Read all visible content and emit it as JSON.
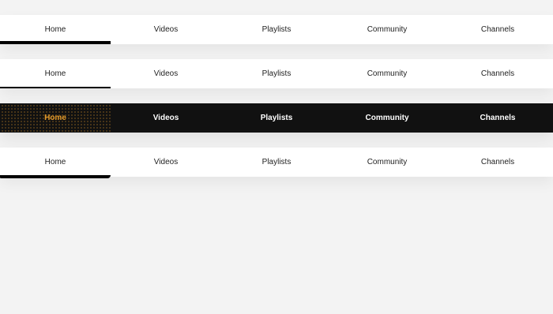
{
  "nav_bars": [
    {
      "tabs": [
        {
          "label": "Home"
        },
        {
          "label": "Videos"
        },
        {
          "label": "Playlists"
        },
        {
          "label": "Community"
        },
        {
          "label": "Channels"
        }
      ],
      "active_index": 0,
      "style": "thick-underline"
    },
    {
      "tabs": [
        {
          "label": "Home"
        },
        {
          "label": "Videos"
        },
        {
          "label": "Playlists"
        },
        {
          "label": "Community"
        },
        {
          "label": "Channels"
        }
      ],
      "active_index": 0,
      "style": "thin-underline"
    },
    {
      "tabs": [
        {
          "label": "Home"
        },
        {
          "label": "Videos"
        },
        {
          "label": "Playlists"
        },
        {
          "label": "Community"
        },
        {
          "label": "Channels"
        }
      ],
      "active_index": 0,
      "style": "dark-highlight",
      "colors": {
        "background": "#111111",
        "text": "#ffffff",
        "active_text": "#e39a2a"
      }
    },
    {
      "tabs": [
        {
          "label": "Home"
        },
        {
          "label": "Videos"
        },
        {
          "label": "Playlists"
        },
        {
          "label": "Community"
        },
        {
          "label": "Channels"
        }
      ],
      "active_index": 0,
      "style": "rounded-underline"
    }
  ]
}
